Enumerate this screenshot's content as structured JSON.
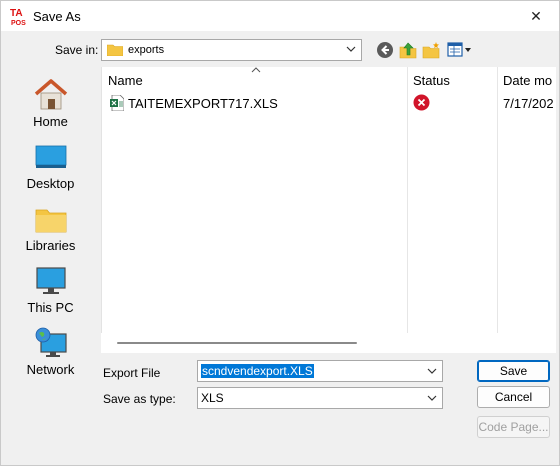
{
  "window": {
    "title": "Save As",
    "app_logo_text": "TA POS",
    "close_glyph": "✕"
  },
  "toolbar": {
    "save_in_label": "Save in:",
    "save_in_value": "exports",
    "buttons": [
      "back-icon",
      "up-folder-icon",
      "new-folder-icon",
      "view-menu-icon"
    ]
  },
  "places": [
    {
      "label": "Home",
      "icon": "home-icon"
    },
    {
      "label": "Desktop",
      "icon": "desktop-icon"
    },
    {
      "label": "Libraries",
      "icon": "libraries-icon"
    },
    {
      "label": "This PC",
      "icon": "this-pc-icon"
    },
    {
      "label": "Network",
      "icon": "network-icon"
    }
  ],
  "file_list": {
    "columns": [
      "Name",
      "Status",
      "Date mo"
    ],
    "rows": [
      {
        "name": "TAITEMEXPORT717.XLS",
        "status": "error-icon",
        "date": "7/17/202"
      }
    ]
  },
  "form": {
    "export_file_label": "Export File",
    "export_file_value": "scndvendexport.XLS",
    "save_as_type_label": "Save as type:",
    "save_as_type_value": "XLS"
  },
  "buttons": {
    "save": "Save",
    "cancel": "Cancel",
    "code_page": "Code Page..."
  },
  "colors": {
    "accent": "#0078d7",
    "error": "#d1142a",
    "folder": "#f4c542"
  }
}
